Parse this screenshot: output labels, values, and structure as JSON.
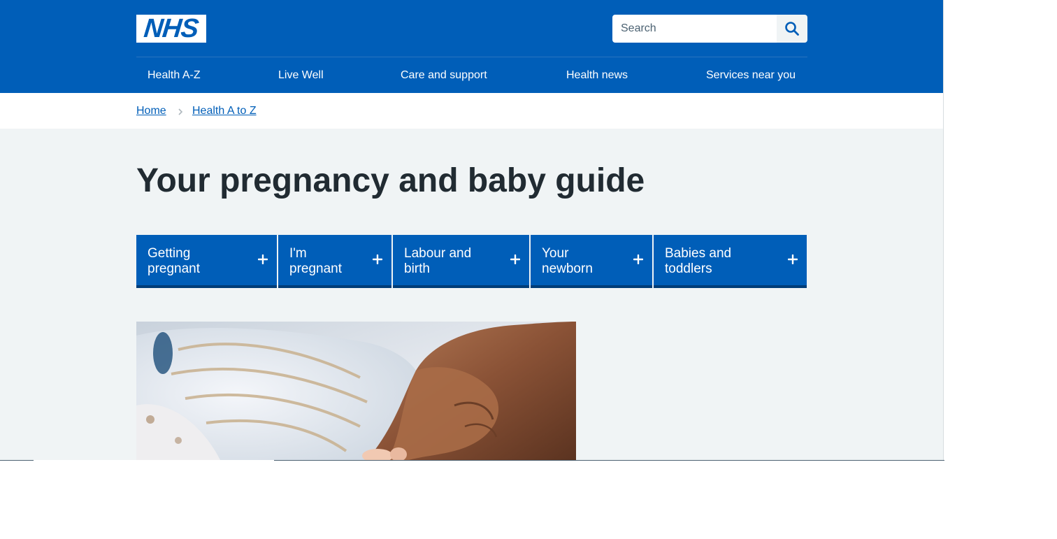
{
  "header": {
    "logo_text": "NHS",
    "search": {
      "placeholder": "Search"
    },
    "nav": [
      "Health A-Z",
      "Live Well",
      "Care and support",
      "Health news",
      "Services near you"
    ]
  },
  "breadcrumb": [
    "Home",
    "Health A to Z"
  ],
  "page_title": "Your pregnancy and baby guide",
  "tabs": [
    "Getting\npregnant",
    "I'm\npregnant",
    "Labour and\nbirth",
    "Your\nnewborn",
    "Babies and\ntoddlers"
  ],
  "icons": {
    "search": "search-icon",
    "breadcrumb_separator": "chevron-right-icon",
    "expand": "plus-icon"
  },
  "colors": {
    "nhs_blue": "#005eb8",
    "dark_blue": "#003d78",
    "page_background": "#f0f4f5",
    "text": "#212b32",
    "secondary_text": "#4c6272"
  }
}
